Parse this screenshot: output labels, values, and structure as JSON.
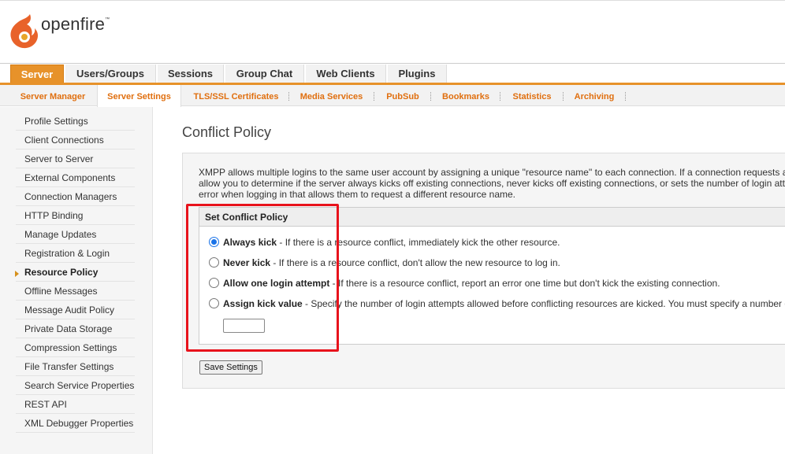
{
  "brand": {
    "name": "openfire",
    "trademark": "™",
    "colors": {
      "primary": "#e7922a",
      "flame": "#e8622a",
      "link": "#e06f0f"
    }
  },
  "main_tabs": [
    {
      "label": "Server",
      "active": true
    },
    {
      "label": "Users/Groups"
    },
    {
      "label": "Sessions"
    },
    {
      "label": "Group Chat"
    },
    {
      "label": "Web Clients"
    },
    {
      "label": "Plugins"
    }
  ],
  "sub_tabs": [
    {
      "label": "Server Manager"
    },
    {
      "label": "Server Settings",
      "active": true
    },
    {
      "label": "TLS/SSL Certificates"
    },
    {
      "label": "Media Services"
    },
    {
      "label": "PubSub"
    },
    {
      "label": "Bookmarks"
    },
    {
      "label": "Statistics"
    },
    {
      "label": "Archiving"
    }
  ],
  "sidebar": {
    "items": [
      {
        "label": "Profile Settings"
      },
      {
        "label": "Client Connections"
      },
      {
        "label": "Server to Server"
      },
      {
        "label": "External Components"
      },
      {
        "label": "Connection Managers"
      },
      {
        "label": "HTTP Binding"
      },
      {
        "label": "Manage Updates"
      },
      {
        "label": "Registration & Login"
      },
      {
        "label": "Resource Policy",
        "active": true
      },
      {
        "label": "Offline Messages"
      },
      {
        "label": "Message Audit Policy"
      },
      {
        "label": "Private Data Storage"
      },
      {
        "label": "Compression Settings"
      },
      {
        "label": "File Transfer Settings"
      },
      {
        "label": "Search Service Properties"
      },
      {
        "label": "REST API"
      },
      {
        "label": "XML Debugger Properties"
      }
    ]
  },
  "content": {
    "title": "Conflict Policy",
    "intro_lines": [
      "XMPP allows multiple logins to the same user account by assigning a unique \"resource name\" to each connection. If a connection requests a",
      "allow you to determine if the server always kicks off existing connections, never kicks off existing connections, or sets the number of login atte",
      "error when logging in that allows them to request a different resource name."
    ],
    "box_title": "Set Conflict Policy",
    "options": [
      {
        "label": "Always kick",
        "desc": " - If there is a resource conflict, immediately kick the other resource.",
        "checked": true
      },
      {
        "label": "Never kick",
        "desc": " - If there is a resource conflict, don't allow the new resource to log in.",
        "checked": false
      },
      {
        "label": "Allow one login attempt",
        "desc": " - If there is a resource conflict, report an error one time but don't kick the existing connection.",
        "checked": false
      },
      {
        "label": "Assign kick value",
        "desc": " - Specify the number of login attempts allowed before conflicting resources are kicked. You must specify a number g",
        "checked": false
      }
    ],
    "kick_value": "",
    "save_label": "Save Settings"
  }
}
